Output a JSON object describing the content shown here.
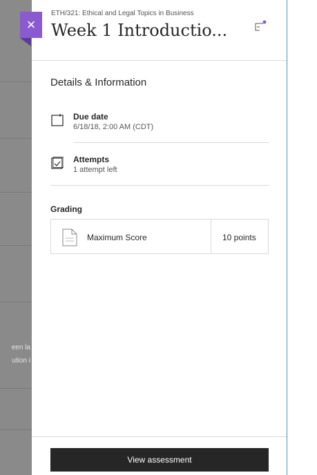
{
  "background": {
    "text_lines": [
      "een la",
      "ution i"
    ]
  },
  "panel": {
    "course_name": "ETH/321: Ethical and Legal Topics in Business",
    "title": "Week 1 Introductio...",
    "section_title": "Details & Information",
    "due_date": {
      "label": "Due date",
      "value": "6/18/18, 2:00 AM (CDT)"
    },
    "attempts": {
      "label": "Attempts",
      "value": "1 attempt left"
    },
    "grading": {
      "label": "Grading",
      "row": {
        "name": "Maximum Score",
        "points": "10 points"
      }
    },
    "primary_button": "View assessment"
  },
  "colors": {
    "accent": "#8a5ad1",
    "button_dark": "#262626"
  }
}
